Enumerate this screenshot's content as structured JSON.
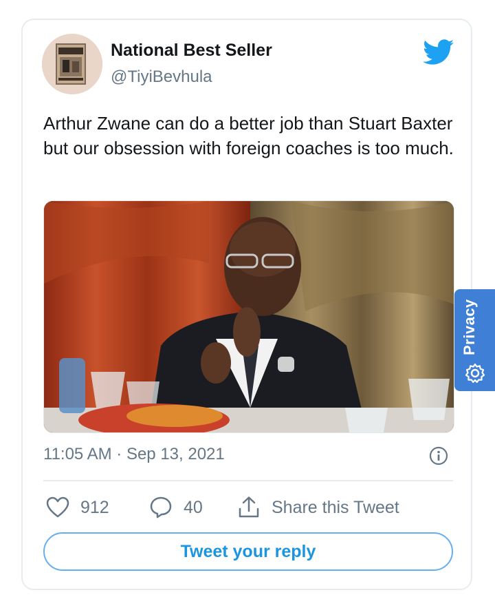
{
  "tweet": {
    "author_name": "National Best Seller",
    "author_handle": "@TiyiBevhula",
    "text": "Arthur Zwane can do a better job than Stuart Baxter but our obsession with foreign coaches is too much.",
    "timestamp": "11:05 AM · Sep 13, 2021"
  },
  "actions": {
    "likes": "912",
    "replies": "40",
    "share_label": "Share this Tweet"
  },
  "reply_button": {
    "label": "Tweet your reply"
  },
  "privacy_tab": {
    "label": "Privacy"
  },
  "icons": {
    "brand": "twitter-bird-icon",
    "info": "info-icon",
    "like": "heart-icon",
    "reply": "speech-bubble-icon",
    "share": "share-upload-icon",
    "privacy": "gear-icon"
  },
  "colors": {
    "twitter_blue": "#1da1f2",
    "reply_text": "#1b95e0",
    "secondary_text": "#657786",
    "primary_text": "#14171a",
    "privacy_bg": "#3f7fd6"
  }
}
